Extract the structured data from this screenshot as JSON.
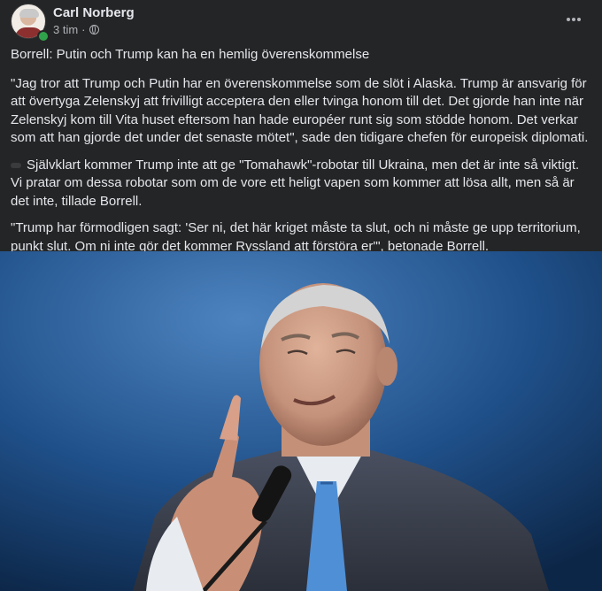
{
  "author": {
    "name": "Carl Norberg",
    "time": "3 tim",
    "separator": "·",
    "privacy_icon": "globe-icon",
    "online": true
  },
  "more_icon": "more-horizontal-icon",
  "post": {
    "headline": "Borrell: Putin och Trump kan ha en hemlig överenskommelse",
    "paragraphs": [
      "\"Jag tror att Trump och Putin har en överenskommelse som de slöt i Alaska. Trump är ansvarig för att övertyga Zelenskyj att frivilligt acceptera den eller tvinga honom till det. Det gjorde han inte när Zelenskyj kom till Vita huset eftersom han hade européer runt sig som stödde honom. Det verkar som att han gjorde det under det senaste mötet\", sade den tidigare chefen för europeisk diplomati.",
      "Självklart kommer Trump inte att ge \"Tomahawk\"-robotar till Ukraina, men det är inte så viktigt. Vi pratar om dessa robotar som om de vore ett heligt vapen som kommer att lösa allt, men så är det inte, tillade Borrell.",
      "\"Trump har förmodligen sagt: 'Ser ni, det här kriget måste ta slut, och ni måste ge upp territorium, punkt slut. Om ni inte gör det kommer Ryssland att förstöra er'\", betonade Borrell."
    ]
  },
  "colors": {
    "background": "#242526",
    "text": "#e4e6eb",
    "secondary_text": "#b0b3b8",
    "online": "#31a24c"
  }
}
